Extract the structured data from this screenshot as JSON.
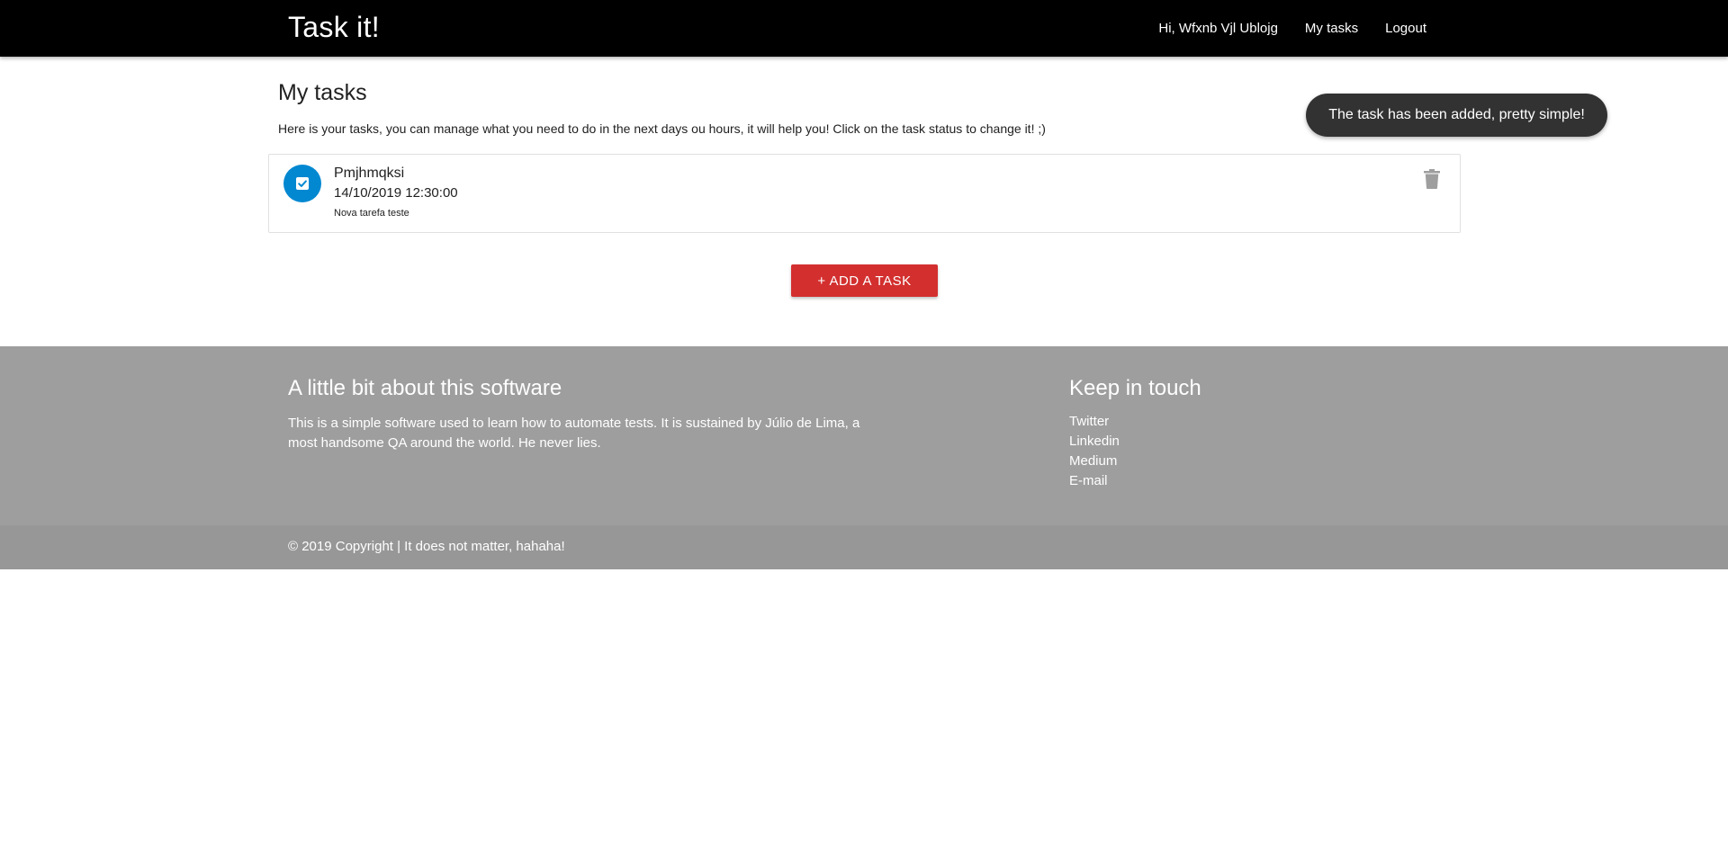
{
  "navbar": {
    "brand": "Task it!",
    "greeting": "Hi, Wfxnb Vjl Ublojg",
    "my_tasks": "My tasks",
    "logout": "Logout"
  },
  "main": {
    "title": "My tasks",
    "intro": "Here is your tasks, you can manage what you need to do in the next days ou hours, it will help you! Click on the task status to change it! ;)",
    "tasks": [
      {
        "name": "Pmjhmqksi",
        "date": "14/10/2019 12:30:00",
        "description": "Nova tarefa teste",
        "status_icon": "check-square-icon",
        "delete_icon": "trash-icon"
      }
    ],
    "add_button": "+ ADD A TASK"
  },
  "toast": {
    "message": "The task has been added, pretty simple!"
  },
  "footer": {
    "about_heading": "A little bit about this software",
    "about_text": "This is a simple software used to learn how to automate tests. It is sustained by Júlio de Lima, a most handsome QA around the world. He never lies.",
    "contact_heading": "Keep in touch",
    "links": [
      "Twitter",
      "Linkedin",
      "Medium",
      "E-mail"
    ],
    "copyright": "© 2019 Copyright | It does not matter, hahaha!"
  },
  "colors": {
    "navbar": "#000000",
    "status": "#0288d1",
    "accent_button": "#d32f2f",
    "toast": "#323232",
    "footer": "#9e9e9e",
    "footer_copyright": "#979797"
  }
}
